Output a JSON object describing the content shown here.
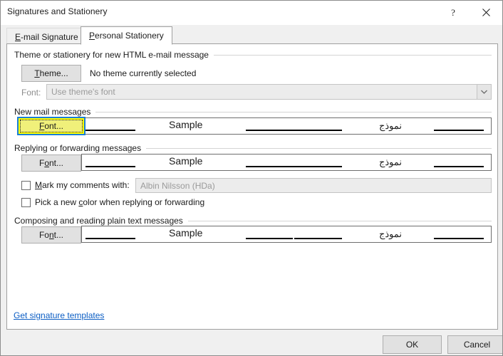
{
  "window": {
    "title": "Signatures and Stationery",
    "help_icon": "?",
    "close_icon": "✕"
  },
  "tabs": [
    {
      "label_pre": "E",
      "label_acc": "-",
      "label": "E-mail Signature",
      "acc_char": "E",
      "active": false
    },
    {
      "label": "Personal Stationery",
      "acc_char": "P",
      "active": true
    }
  ],
  "groups": {
    "theme": {
      "title": "Theme or stationery for new HTML e-mail message",
      "theme_button": "Theme...",
      "theme_button_acc": "T",
      "theme_status": "No theme currently selected",
      "font_label": "Font:",
      "font_value": "Use theme's font",
      "dropdown_icon": "chevron-down-icon"
    },
    "new_mail": {
      "title": "New mail messages",
      "font_button": "Font...",
      "font_button_acc": "F",
      "focused": true,
      "focus_highlight_color": "#ffff00",
      "focus_border_color": "#1a7fd4"
    },
    "reply": {
      "title": "Replying or forwarding messages",
      "font_button": "Font...",
      "font_button_acc": "o",
      "mark_comments_label": "Mark my comments with:",
      "mark_comments_acc": "M",
      "mark_comments_checked": false,
      "mark_comments_value": "Albin Nilsson (HDa)",
      "pick_color_label": "Pick a new color when replying or forwarding",
      "pick_color_acc": "c",
      "pick_color_checked": false
    },
    "plain_text": {
      "title": "Composing and reading plain text messages",
      "font_button": "Font...",
      "font_button_acc": "n"
    }
  },
  "sample": {
    "latin_text": "Sample",
    "arabic_text": "نموذج"
  },
  "link": {
    "label": "Get signature templates"
  },
  "footer": {
    "ok": "OK",
    "cancel": "Cancel"
  }
}
